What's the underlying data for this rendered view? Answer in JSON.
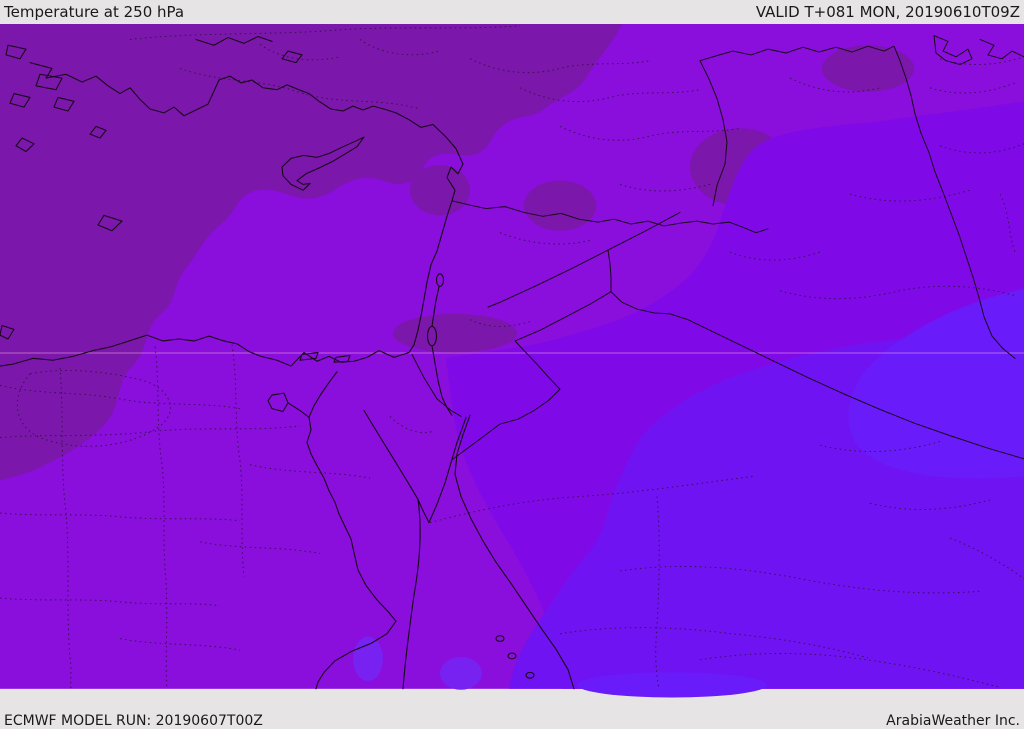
{
  "header": {
    "title": "Temperature at 250 hPa",
    "valid": "VALID T+081 MON, 20190610T09Z"
  },
  "footer": {
    "model_run": "ECMWF MODEL RUN: 20190607T00Z",
    "credit": "ArabiaWeather Inc."
  },
  "map": {
    "description": "ECMWF upper-air temperature shading over the Middle East (Turkey, Cyprus, Levant, Egypt, Iraq, Saudi Arabia, Iran)",
    "colors": {
      "coldest": "#7C17AC",
      "base": "#8A0EDC",
      "mild": "#8009E8",
      "warm": "#7013F2",
      "warmest": "#6A1BFA",
      "blob": "#7722F0",
      "border": "#180818",
      "admin": "#2A1038",
      "graticule": "#F2A8DA",
      "bar_bg": "#E6E4E5",
      "bar_text": "#1A1A1A"
    },
    "bands": [
      {
        "name": "coldest-northwest",
        "color": "#7C17AC"
      },
      {
        "name": "base-purple",
        "color": "#8A0EDC"
      },
      {
        "name": "mild-east",
        "color": "#8009E8"
      },
      {
        "name": "warm-southeast",
        "color": "#7013F2"
      },
      {
        "name": "warmest-east-band",
        "color": "#6A1BFA"
      }
    ]
  }
}
